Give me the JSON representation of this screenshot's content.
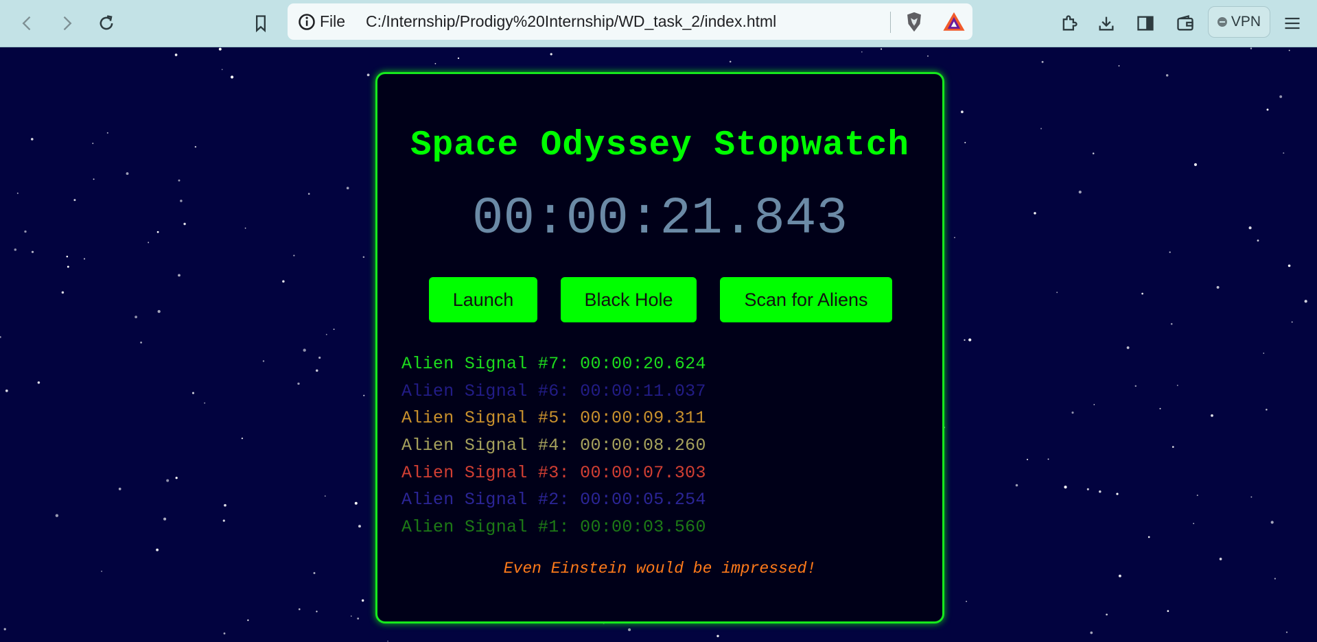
{
  "browser": {
    "file_label": "File",
    "url": "C:/Internship/Prodigy%20Internship/WD_task_2/index.html",
    "vpn_label": "VPN"
  },
  "app": {
    "title": "Space Odyssey Stopwatch",
    "time": "00:00:21.843",
    "buttons": {
      "launch": "Launch",
      "black_hole": "Black Hole",
      "scan": "Scan for Aliens"
    },
    "laps": [
      {
        "text": "Alien Signal #7: 00:00:20.624",
        "color": "#1ddc1d"
      },
      {
        "text": "Alien Signal #6: 00:00:11.037",
        "color": "#221c86"
      },
      {
        "text": "Alien Signal #5: 00:00:09.311",
        "color": "#c9912d"
      },
      {
        "text": "Alien Signal #4: 00:00:08.260",
        "color": "#a6a25c"
      },
      {
        "text": "Alien Signal #3: 00:00:07.303",
        "color": "#d23f33"
      },
      {
        "text": "Alien Signal #2: 00:00:05.254",
        "color": "#2b2596"
      },
      {
        "text": "Alien Signal #1: 00:00:03.560",
        "color": "#1d7a16"
      }
    ],
    "footer": "Even Einstein would be impressed!"
  },
  "colors": {
    "background": "#02033f",
    "accent": "#00ff00",
    "time_color": "#6b8aa6",
    "footer_color": "#ff7a1a"
  }
}
